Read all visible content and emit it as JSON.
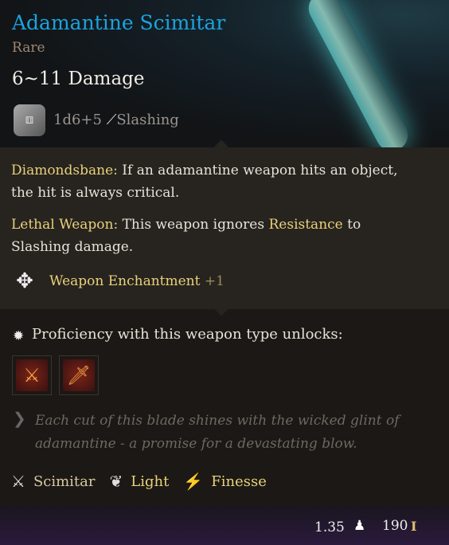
{
  "item": {
    "name": "Adamantine Scimitar",
    "rarity": "Rare",
    "damage": "6~11 Damage",
    "roll": "1d6+5",
    "damage_type": "Slashing"
  },
  "passives": [
    {
      "name": "Diamondsbane:",
      "text": " If an adamantine weapon hits an object, the hit is always critical."
    },
    {
      "name": "Lethal Weapon:",
      "text_before": " This weapon ignores ",
      "keyword": "Resistance",
      "text_after": " to Slashing damage."
    }
  ],
  "enchantment": {
    "label": "Weapon Enchantment",
    "bonus": "+1"
  },
  "proficiency": {
    "label": "Proficiency with this weapon type unlocks:",
    "actions": [
      "action-1",
      "action-2"
    ]
  },
  "lore": "Each cut of this blade shines with the wicked glint of adamantine - a promise for a devastating blow.",
  "properties": [
    {
      "label": "Scimitar",
      "icon": "crossed-swords-icon",
      "color": "#d8c8a0"
    },
    {
      "label": "Light",
      "icon": "feather-icon",
      "color": "#e8d27a"
    },
    {
      "label": "Finesse",
      "icon": "finesse-icon",
      "color": "#e8d27a"
    }
  ],
  "footer": {
    "weight": "1.35",
    "value": "190"
  },
  "colors": {
    "title": "#1aa3e0",
    "rarity": "#a08770",
    "keyword": "#e8d27a"
  }
}
